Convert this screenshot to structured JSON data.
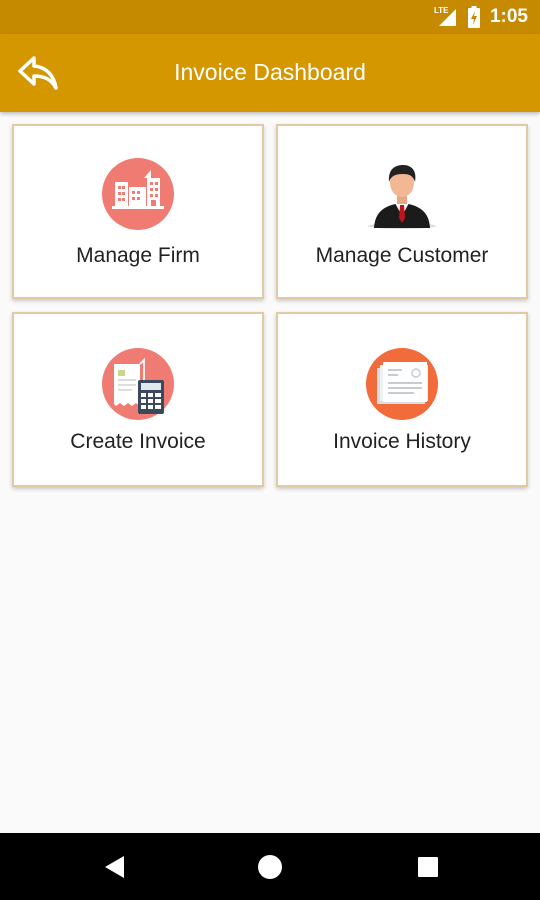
{
  "status_bar": {
    "network_label": "LTE",
    "time": "1:05",
    "icons": [
      "lte-signal-icon",
      "battery-charging-icon"
    ]
  },
  "app_bar": {
    "title": "Invoice Dashboard",
    "back_icon": "reply-arrow-icon"
  },
  "tiles": [
    {
      "label": "Manage Firm",
      "icon": "building-icon",
      "icon_bg": "#f07b73"
    },
    {
      "label": "Manage Customer",
      "icon": "businessman-icon"
    },
    {
      "label": "Create Invoice",
      "icon": "receipt-calculator-icon",
      "icon_bg": "#f07b73"
    },
    {
      "label": "Invoice History",
      "icon": "document-stack-icon",
      "icon_bg": "#f26b3a"
    }
  ],
  "nav_bar": {
    "icons": [
      "back-triangle-icon",
      "home-circle-icon",
      "recents-square-icon"
    ]
  },
  "colors": {
    "status_bar": "#c68a00",
    "app_bar": "#d49700",
    "tile_border": "#e4c9a5",
    "background": "#fafafa"
  }
}
